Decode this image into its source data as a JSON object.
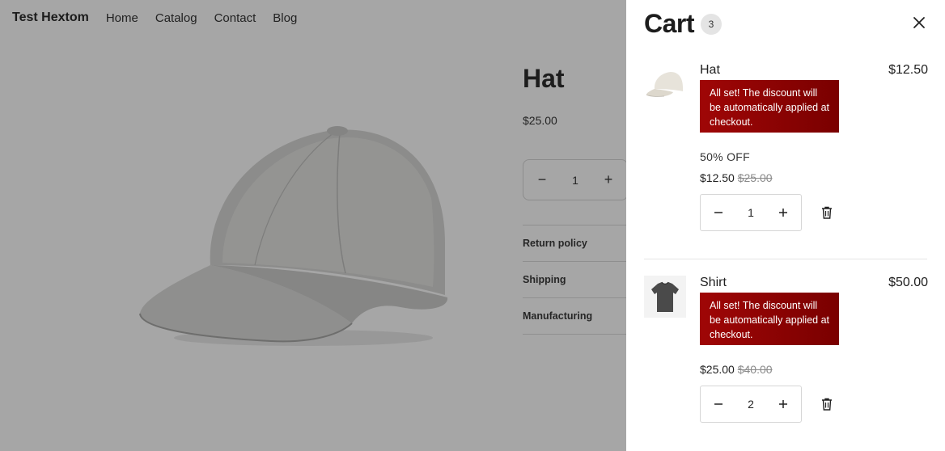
{
  "store": {
    "brand": "Test Hextom",
    "nav": [
      "Home",
      "Catalog",
      "Contact",
      "Blog"
    ]
  },
  "product": {
    "title": "Hat",
    "price": "$25.00",
    "quantity": "1",
    "accordion": [
      "Return policy",
      "Shipping",
      "Manufacturing"
    ]
  },
  "cart": {
    "title": "Cart",
    "count": "3",
    "items": [
      {
        "name": "Hat",
        "total": "$12.50",
        "alert": "All set! The discount will be automatically applied at checkout.",
        "offer": "50% OFF",
        "price": "$12.50",
        "compare_price": "$25.00",
        "quantity": "1"
      },
      {
        "name": "Shirt",
        "total": "$50.00",
        "alert": "All set! The discount will be automatically applied at checkout.",
        "price": "$25.00",
        "compare_price": "$40.00",
        "quantity": "2"
      }
    ]
  },
  "colors": {
    "overlay": "#a6a6a6",
    "alert_bg": "#8b0000",
    "drawer_bg": "#ffffff"
  }
}
